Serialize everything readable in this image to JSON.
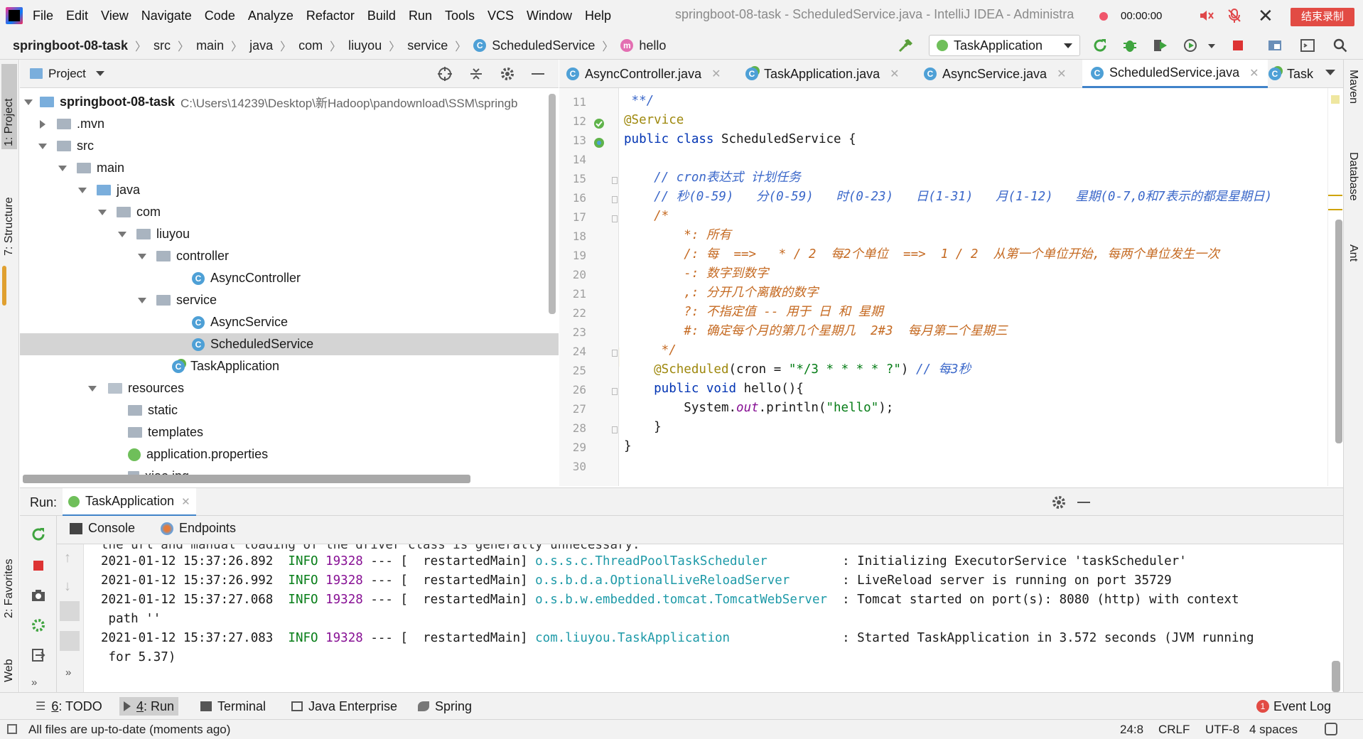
{
  "menubar": {
    "items": [
      "File",
      "Edit",
      "View",
      "Navigate",
      "Code",
      "Analyze",
      "Refactor",
      "Build",
      "Run",
      "Tools",
      "VCS",
      "Window",
      "Help"
    ],
    "window_title": "springboot-08-task - ScheduledService.java - IntelliJ IDEA - Administra",
    "timer": "00:00:00",
    "end_record": "结束录制"
  },
  "navbar": {
    "project": "springboot-08-task",
    "crumbs": [
      "src",
      "main",
      "java",
      "com",
      "liuyou",
      "service"
    ],
    "class_crumb": "ScheduledService",
    "method_crumb": "hello",
    "run_config": "TaskApplication"
  },
  "left_strip": {
    "project": "1: Project",
    "structure": "7: Structure",
    "favorites": "2: Favorites",
    "web": "Web"
  },
  "right_strip": {
    "maven": "Maven",
    "database": "Database",
    "ant": "Ant"
  },
  "project_panel": {
    "title": "Project",
    "root_name": "springboot-08-task",
    "root_path": "C:\\Users\\14239\\Desktop\\新Hadoop\\pandownload\\SSM\\springb",
    "nodes": {
      "mvn": ".mvn",
      "src": "src",
      "main": "main",
      "java": "java",
      "com": "com",
      "liuyou": "liuyou",
      "controller": "controller",
      "async_controller": "AsyncController",
      "service": "service",
      "async_service": "AsyncService",
      "scheduled_service": "ScheduledService",
      "task_application": "TaskApplication",
      "resources": "resources",
      "static": "static",
      "templates": "templates",
      "application_properties": "application.properties",
      "xiao_jpg": "xiao.jpg"
    }
  },
  "editor": {
    "tabs": [
      "AsyncController.java",
      "TaskApplication.java",
      "AsyncService.java",
      "ScheduledService.java",
      "Task"
    ],
    "line_numbers": [
      "11",
      "12",
      "13",
      "14",
      "15",
      "16",
      "17",
      "18",
      "19",
      "20",
      "21",
      "22",
      "23",
      "24",
      "25",
      "26",
      "27",
      "28",
      "29",
      "30"
    ],
    "code": {
      "l11": " **/",
      "l12": "@Service",
      "l13_kw": "public class",
      "l13_rest": " ScheduledService {",
      "l15": "    // cron表达式 计划任务",
      "l16": "    // 秒(0-59)   分(0-59)   时(0-23)   日(1-31)   月(1-12)   星期(0-7,0和7表示的都是星期日)",
      "l17": "    /*",
      "l18": "        *: 所有",
      "l19": "        /: 每  ==>   * / 2  每2个单位  ==>  1 / 2  从第一个单位开始, 每两个单位发生一次",
      "l20": "        -: 数字到数字",
      "l21": "        ,: 分开几个离散的数字",
      "l22": "        ?: 不指定值 -- 用于 日 和 星期",
      "l23": "        #: 确定每个月的第几个星期几  2#3  每月第二个星期三",
      "l24": "     */",
      "l25_ann": "    @Scheduled",
      "l25_mid": "(cron = ",
      "l25_str": "\"*/3 * * * * ?\"",
      "l25_end": ") ",
      "l25_cm": "// 每3秒",
      "l26_kw": "    public void",
      "l26_rest": " hello(){",
      "l27_a": "        System.",
      "l27_fld": "out",
      "l27_b": ".println(",
      "l27_str": "\"hello\"",
      "l27_c": ");",
      "l28": "    }",
      "l29": "}"
    }
  },
  "run_panel": {
    "label": "Run:",
    "config": "TaskApplication",
    "tabs": [
      "Console",
      "Endpoints"
    ],
    "cut_line": "the url and manual loading of the driver class is generally unnecessary.",
    "logs": [
      {
        "ts": "2021-01-12 15:37:26.892",
        "level": "INFO",
        "pid": "19328",
        "sep": " --- [  restartedMain] ",
        "cls": "o.s.s.c.ThreadPoolTaskScheduler         ",
        "msg": " : Initializing ExecutorService 'taskScheduler'"
      },
      {
        "ts": "2021-01-12 15:37:26.992",
        "level": "INFO",
        "pid": "19328",
        "sep": " --- [  restartedMain] ",
        "cls": "o.s.b.d.a.OptionalLiveReloadServer      ",
        "msg": " : LiveReload server is running on port 35729"
      },
      {
        "ts": "2021-01-12 15:37:27.068",
        "level": "INFO",
        "pid": "19328",
        "sep": " --- [  restartedMain] ",
        "cls": "o.s.b.w.embedded.tomcat.TomcatWebServer ",
        "msg": " : Tomcat started on port(s): 8080 (http) with context"
      },
      {
        "ts": "2021-01-12 15:37:27.083",
        "level": "INFO",
        "pid": "19328",
        "sep": " --- [  restartedMain] ",
        "cls": "com.liuyou.TaskApplication              ",
        "msg": " : Started TaskApplication in 3.572 seconds (JVM running"
      }
    ],
    "wrap1": " path ''",
    "wrap2": " for 5.37)"
  },
  "bottom_tabs": {
    "todo_num": "6",
    "todo": ": TODO",
    "run_num": "4",
    "run": ": Run",
    "terminal": "Terminal",
    "java_enterprise": "Java Enterprise",
    "spring": "Spring",
    "event_log_count": "1",
    "event_log": "Event Log"
  },
  "status": {
    "message": "All files are up-to-date (moments ago)",
    "position": "24:8",
    "line_sep": "CRLF",
    "encoding": "UTF-8",
    "indent": "4 spaces"
  },
  "colors": {
    "accent": "#4083c9",
    "record": "#e24b44",
    "keyword": "#0033b3",
    "annotation": "#9e880d",
    "string": "#067d17",
    "comment": "#3a67c9"
  }
}
